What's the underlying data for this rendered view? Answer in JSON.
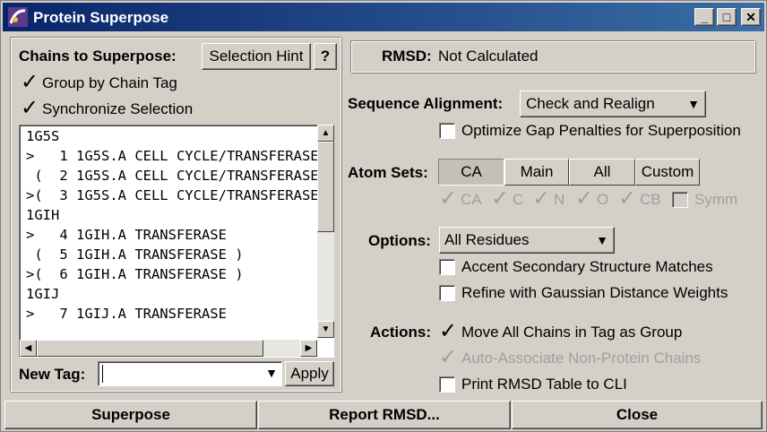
{
  "window": {
    "title": "Protein Superpose"
  },
  "left": {
    "chains_label": "Chains to Superpose:",
    "selection_hint": "Selection Hint",
    "help": "?",
    "group_by_tag": {
      "label": "Group by Chain Tag",
      "checked": true
    },
    "sync_selection": {
      "label": "Synchronize Selection",
      "checked": true
    },
    "list_rows": [
      "1G5S",
      ">   1 1G5S.A CELL CYCLE/TRANSFERASE",
      " (  2 1G5S.A CELL CYCLE/TRANSFERASE",
      ">(  3 1G5S.A CELL CYCLE/TRANSFERASE",
      "1GIH",
      ">   4 1GIH.A TRANSFERASE",
      " (  5 1GIH.A TRANSFERASE )",
      ">(  6 1GIH.A TRANSFERASE )",
      "1GIJ",
      ">   7 1GIJ.A TRANSFERASE"
    ],
    "new_tag_label": "New Tag:",
    "new_tag_value": "",
    "apply": "Apply"
  },
  "rmsd": {
    "label": "RMSD:",
    "value": "Not Calculated"
  },
  "alignment": {
    "label": "Sequence Alignment:",
    "value": "Check and Realign",
    "optimize_gap": {
      "label": "Optimize Gap Penalties for Superposition",
      "checked": false
    }
  },
  "atom_sets": {
    "label": "Atom Sets:",
    "tabs": [
      "CA",
      "Main",
      "All",
      "Custom"
    ],
    "selected_tab": "CA",
    "atoms": [
      {
        "label": "CA",
        "checked": true
      },
      {
        "label": "C",
        "checked": true
      },
      {
        "label": "N",
        "checked": true
      },
      {
        "label": "O",
        "checked": true
      },
      {
        "label": "CB",
        "checked": true
      },
      {
        "label": "Symm",
        "checked": false
      }
    ]
  },
  "options": {
    "label": "Options:",
    "value": "All Residues",
    "accent": {
      "label": "Accent Secondary Structure Matches",
      "checked": false
    },
    "refine": {
      "label": "Refine with Gaussian Distance Weights",
      "checked": false
    }
  },
  "actions": {
    "label": "Actions:",
    "move_all": {
      "label": "Move All Chains in Tag as Group",
      "checked": true
    },
    "auto_assoc": {
      "label": "Auto-Associate Non-Protein Chains",
      "checked": true,
      "disabled": true
    },
    "print_rmsd": {
      "label": "Print RMSD Table to CLI",
      "checked": false
    }
  },
  "bottom": {
    "superpose": "Superpose",
    "report": "Report RMSD...",
    "close": "Close"
  },
  "glyphs": {
    "check": "✓",
    "down": "▼",
    "up": "▲",
    "left": "◀",
    "right": "▶"
  },
  "colors": {
    "title_start": "#0a246a",
    "title_end": "#3a6ea5",
    "face": "#d4d0c8",
    "disabled": "#a0a0a0"
  }
}
